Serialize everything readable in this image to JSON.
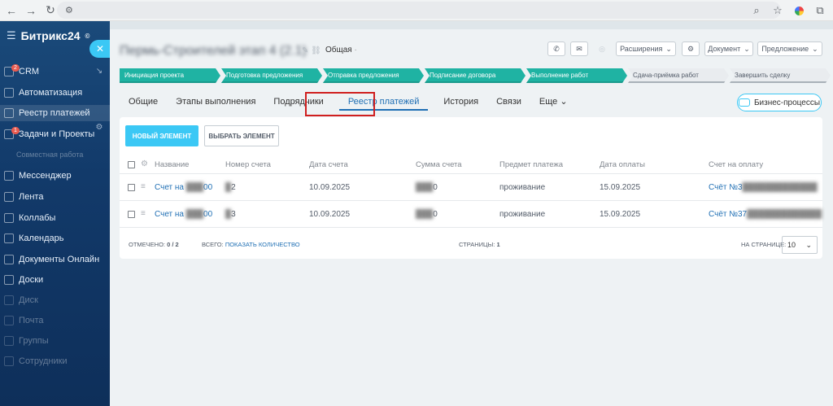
{
  "browser": {
    "icons": [
      "back-icon",
      "forward-icon",
      "reload-icon",
      "site-settings-icon",
      "zoom-icon",
      "bookmark-star-icon",
      "profile-icon",
      "extensions-icon"
    ]
  },
  "sidebar": {
    "logo": "Битрикс24",
    "logo_sup": "©",
    "items": [
      {
        "label": "CRM",
        "badge": "2"
      },
      {
        "label": "Автоматизация"
      },
      {
        "label": "Реестр платежей"
      },
      {
        "label": "Задачи и Проекты",
        "badge": "1"
      },
      {
        "label": "Совместная работа"
      },
      {
        "label": "Мессенджер"
      },
      {
        "label": "Лента"
      },
      {
        "label": "Коллабы"
      },
      {
        "label": "Календарь"
      },
      {
        "label": "Документы Онлайн"
      },
      {
        "label": "Доски"
      },
      {
        "label": "Диск"
      },
      {
        "label": "Почта"
      },
      {
        "label": "Группы"
      },
      {
        "label": "Сотрудники"
      }
    ]
  },
  "header": {
    "title": "Пермь-Строителей этап 4 (2.1)",
    "category": "Общая",
    "expansions_label": "Расширения",
    "document_label": "Документ",
    "offer_label": "Предложение"
  },
  "stages": [
    {
      "label": "Инициация проекта",
      "active": true
    },
    {
      "label": "Подготовка предложения",
      "active": true
    },
    {
      "label": "Отправка предложения",
      "active": true
    },
    {
      "label": "Подписание договора",
      "active": true
    },
    {
      "label": "Выполнение работ",
      "active": true
    },
    {
      "label": "Сдача-приёмка работ",
      "active": false
    },
    {
      "label": "Завершить сделку",
      "active": false
    }
  ],
  "tabs": [
    "Общие",
    "Этапы выполнения",
    "Подрядчики",
    "Реестр платежей",
    "История",
    "Связи",
    "Еще"
  ],
  "active_tab": "Реестр платежей",
  "business_processes_label": "Бизнес-процессы",
  "toolbar": {
    "new_label": "НОВЫЙ ЭЛЕМЕНТ",
    "choose_label": "ВЫБРАТЬ ЭЛЕМЕНТ"
  },
  "table": {
    "columns": [
      "Название",
      "Номер счета",
      "Дата счета",
      "Сумма счета",
      "Предмет платежа",
      "Дата оплаты",
      "Счет на оплату"
    ],
    "rows": [
      {
        "name": "Счет на",
        "name_tail": "00",
        "number": "2",
        "date": "10.09.2025",
        "sum": "0",
        "subject": "проживание",
        "paid": "15.09.2025",
        "invoice": "Счёт №3"
      },
      {
        "name": "Счет на",
        "name_tail": "00",
        "number": "3",
        "date": "10.09.2025",
        "sum": "0",
        "subject": "проживание",
        "paid": "15.09.2025",
        "invoice": "Счёт №37"
      }
    ]
  },
  "footer": {
    "marked_label": "ОТМЕЧЕНО:",
    "marked_value": "0 / 2",
    "total_label": "ВСЕГО:",
    "total_link": "ПОКАЗАТЬ КОЛИЧЕСТВО",
    "pages_label": "СТРАНИЦЫ:",
    "pages_value": "1",
    "per_page_label": "НА СТРАНИЦЕ:",
    "per_page_value": "10"
  },
  "colors": {
    "accent": "#3bc8f5",
    "stage_active": "#1fb3a3",
    "link": "#1f6fb4",
    "highlight": "#d01f1f"
  }
}
